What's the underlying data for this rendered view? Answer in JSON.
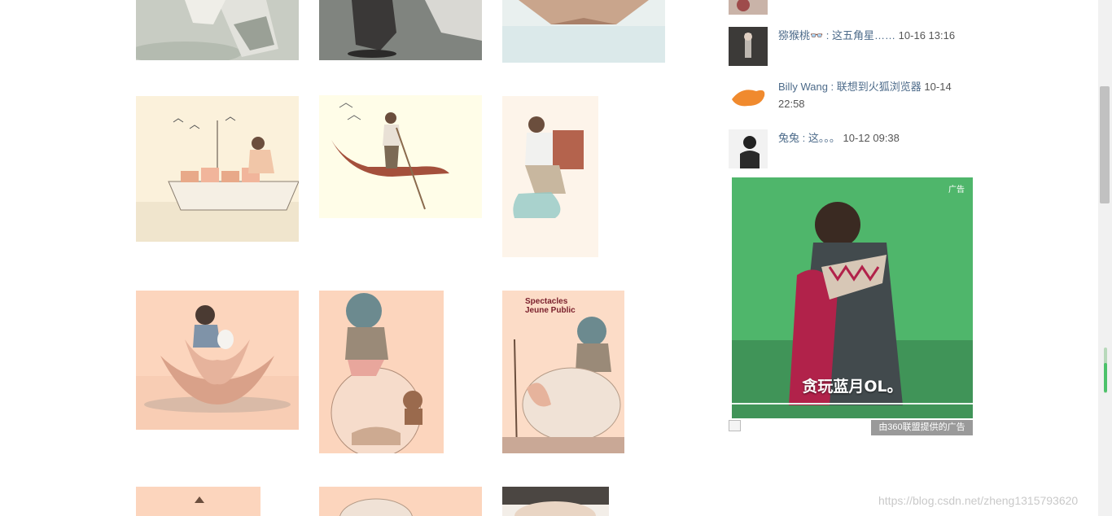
{
  "gallery": {
    "tiles": [
      {
        "name": "illustration-girl-swan"
      },
      {
        "name": "illustration-dark-skirt"
      },
      {
        "name": "illustration-paper-boat"
      },
      {
        "name": "illustration-boat-village"
      },
      {
        "name": "illustration-gondolier"
      },
      {
        "name": "illustration-backpack-man"
      },
      {
        "name": "illustration-lotus-girl"
      },
      {
        "name": "illustration-boy-on-sphere"
      },
      {
        "name": "illustration-spectacles-poster",
        "title_lines": [
          "Spectacles",
          "Jeune Public"
        ]
      },
      {
        "name": "illustration-bottom-1"
      },
      {
        "name": "illustration-bottom-2"
      },
      {
        "name": "illustration-bottom-3"
      }
    ]
  },
  "comments": [
    {
      "author": "猕猴桃👓",
      "text": "这五角星……",
      "time": "10-16 13:16"
    },
    {
      "author": "Billy Wang",
      "text": "联想到火狐浏览器",
      "time": "10-14 22:58"
    },
    {
      "author": "兔兔",
      "text": "这。。。",
      "time": "10-12 09:38"
    }
  ],
  "ad": {
    "badge": "广告",
    "caption": "贪玩蓝月OL。",
    "footer": "由360联盟提供的广告",
    "bg_color": "#4fb66b"
  },
  "watermark": "https://blog.csdn.net/zheng1315793620",
  "colors": {
    "peach": "#fcd5bd",
    "cream": "#fffbe8",
    "link": "#4d6b8a"
  }
}
